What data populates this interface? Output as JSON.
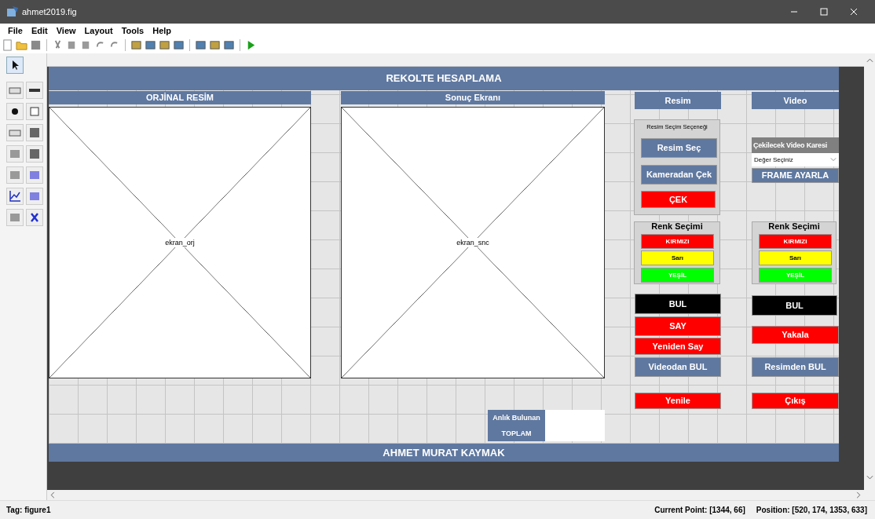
{
  "window": {
    "title": "ahmet2019.fig"
  },
  "menu": [
    "File",
    "Edit",
    "View",
    "Layout",
    "Tools",
    "Help"
  ],
  "figure": {
    "header": "REKOLTE HESAPLAMA",
    "axes": [
      {
        "title": "ORJİNAL RESİM",
        "tag": "ekran_orj"
      },
      {
        "title": "Sonuç Ekranı",
        "tag": "ekran_snc"
      }
    ],
    "columns": [
      {
        "items": [
          {
            "kind": "heading",
            "text": "Resim"
          },
          {
            "kind": "panel",
            "title": "Resim Seçim Seçeneği",
            "buttons": [
              {
                "label": "Resim Seç",
                "color": "#5f78a0"
              },
              {
                "label": "Kameradan Çek",
                "color": "#5f78a0"
              },
              {
                "label": "ÇEK",
                "color": "#ff0000"
              }
            ]
          },
          {
            "kind": "color_panel",
            "title": "Renk Seçimi",
            "buttons": [
              {
                "label": "KIRMIZI",
                "color": "#ff0000"
              },
              {
                "label": "Sarı",
                "color": "#ffff00"
              },
              {
                "label": "YEŞİL",
                "color": "#00ff00"
              }
            ]
          },
          {
            "kind": "button",
            "label": "BUL",
            "color": "#000000"
          },
          {
            "kind": "button",
            "label": "SAY",
            "color": "#ff0000"
          },
          {
            "kind": "button",
            "label": "Yeniden Say",
            "color": "#ff0000"
          },
          {
            "kind": "button",
            "label": "Videodan BUL",
            "color": "#5f78a0"
          },
          {
            "kind": "button",
            "label": "Yenile",
            "color": "#ff0000"
          }
        ]
      },
      {
        "items": [
          {
            "kind": "heading",
            "text": "Video"
          },
          {
            "kind": "label",
            "text": "Çekilecek Video Karesi"
          },
          {
            "kind": "dropdown",
            "value": "Değer Seçiniz"
          },
          {
            "kind": "button",
            "label": "FRAME AYARLA",
            "color": "#5f78a0"
          },
          {
            "kind": "color_panel",
            "title": "Renk Seçimi",
            "buttons": [
              {
                "label": "KIRMIZI",
                "color": "#ff0000"
              },
              {
                "label": "Sarı",
                "color": "#ffff00"
              },
              {
                "label": "YEŞİL",
                "color": "#00ff00"
              }
            ]
          },
          {
            "kind": "button",
            "label": "BUL",
            "color": "#000000"
          },
          {
            "kind": "button",
            "label": "Yakala",
            "color": "#ff0000"
          },
          {
            "kind": "button",
            "label": "Resimden BUL",
            "color": "#5f78a0"
          },
          {
            "kind": "button",
            "label": "Çıkış",
            "color": "#ff0000"
          }
        ]
      }
    ],
    "total": {
      "label_lines": [
        "Anlık Bulunan",
        "TOPLAM"
      ]
    },
    "footer": "AHMET MURAT KAYMAK"
  },
  "status_bar": {
    "tag": "Tag: figure1",
    "current_point": "Current Point: [1344, 66]",
    "position": "Position: [520, 174, 1353, 633]"
  }
}
